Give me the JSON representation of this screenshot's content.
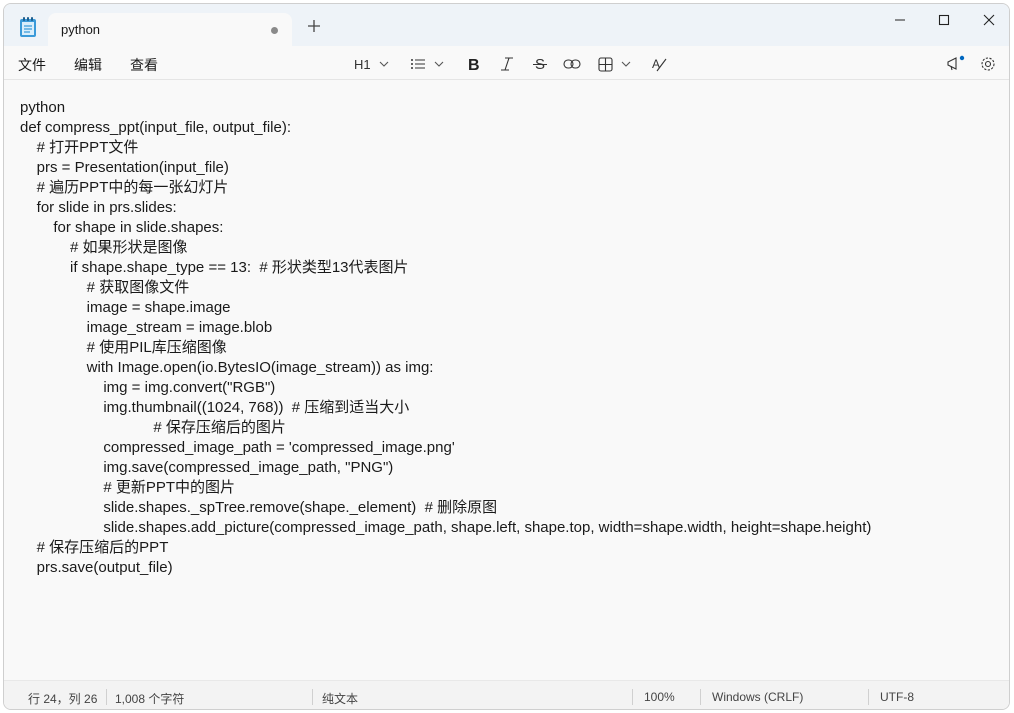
{
  "tab": {
    "title": "python"
  },
  "menu": {
    "file": "文件",
    "edit": "编辑",
    "view": "查看"
  },
  "toolbar": {
    "heading_label": "H1",
    "icons": [
      "list-icon",
      "bold-icon",
      "italic-icon",
      "strikethrough-icon",
      "link-icon",
      "table-icon",
      "clear-format-icon",
      "whats-new-icon",
      "settings-icon"
    ]
  },
  "editor": {
    "lines": [
      "python",
      "def compress_ppt(input_file, output_file):",
      "    # 打开PPT文件",
      "    prs = Presentation(input_file)",
      "    # 遍历PPT中的每一张幻灯片",
      "    for slide in prs.slides:",
      "        for shape in slide.shapes:",
      "            # 如果形状是图像",
      "            if shape.shape_type == 13:  # 形状类型13代表图片",
      "                # 获取图像文件",
      "                image = shape.image",
      "                image_stream = image.blob",
      "                # 使用PIL库压缩图像",
      "                with Image.open(io.BytesIO(image_stream)) as img:",
      "                    img = img.convert(\"RGB\")",
      "                    img.thumbnail((1024, 768))  # 压缩到适当大小",
      "                                # 保存压缩后的图片",
      "                    compressed_image_path = 'compressed_image.png'",
      "                    img.save(compressed_image_path, \"PNG\")",
      "                    # 更新PPT中的图片",
      "                    slide.shapes._spTree.remove(shape._element)  # 删除原图",
      "                    slide.shapes.add_picture(compressed_image_path, shape.left, shape.top, width=shape.width, height=shape.height)",
      "    # 保存压缩后的PPT",
      "    prs.save(output_file)"
    ]
  },
  "status": {
    "position": "行 24，列 26",
    "chars": "1,008 个字符",
    "format": "纯文本",
    "zoom": "100%",
    "line_ending": "Windows (CRLF)",
    "encoding": "UTF-8"
  },
  "colors": {
    "titlebar": "#eef3f8",
    "accent": "#0067c0",
    "notify_dot": "#0067c0"
  }
}
